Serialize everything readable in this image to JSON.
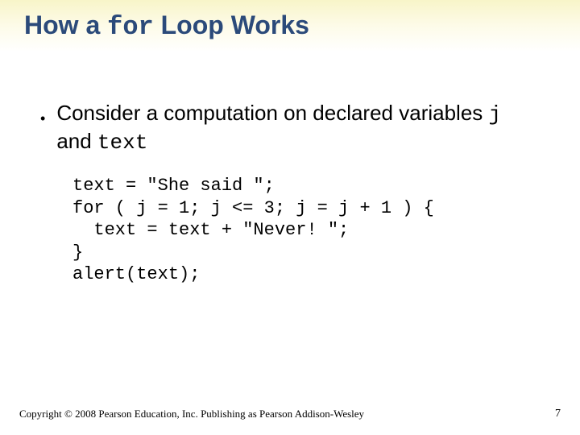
{
  "title": {
    "pre": "How a ",
    "mono": "for",
    "post": " Loop Works"
  },
  "bullet": {
    "pre": "Consider a computation on declared variables ",
    "mono1": "j",
    "mid": " and ",
    "mono2": "text"
  },
  "code": {
    "line1": "text = \"She said \";",
    "line2": "for ( j = 1; j <= 3; j = j + 1 ) {",
    "line3": "  text = text + \"Never! \";",
    "line4": "}",
    "line5": "alert(text);"
  },
  "footer": {
    "copyright": "Copyright © 2008 Pearson Education, Inc. Publishing as Pearson Addison-Wesley",
    "page": "7"
  }
}
